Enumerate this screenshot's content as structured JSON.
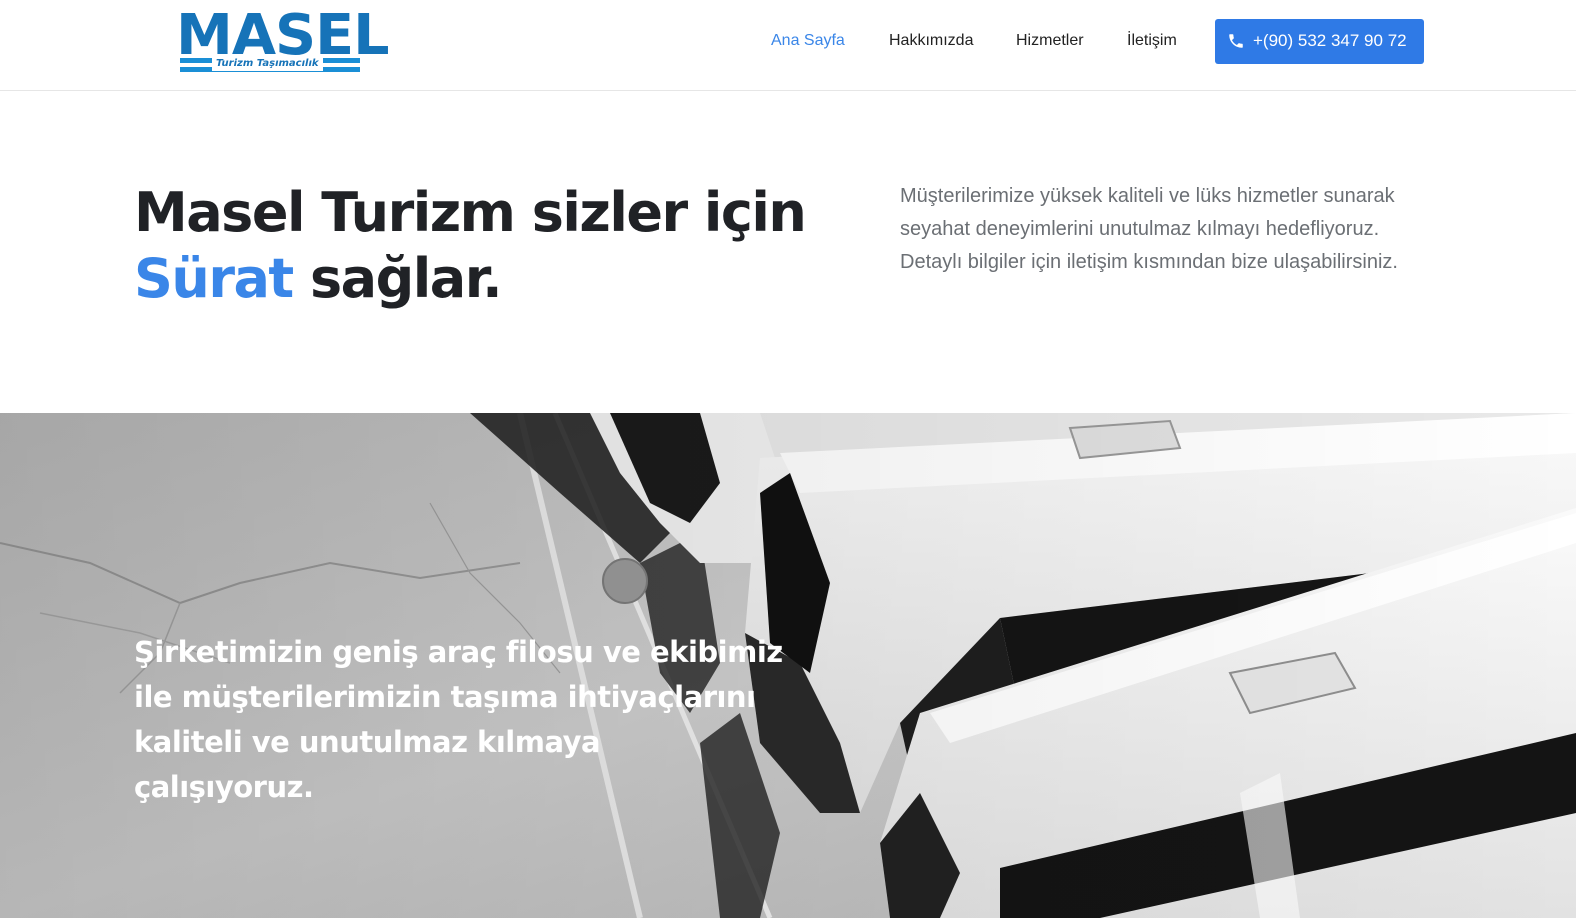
{
  "brand": {
    "logo_word": "MASEL",
    "logo_tagline": "Turizm Taşımacılık",
    "color": "#1673b8"
  },
  "nav": {
    "items": [
      {
        "label": "Ana Sayfa",
        "active": true
      },
      {
        "label": "Hakkımızda",
        "active": false
      },
      {
        "label": "Hizmetler",
        "active": false
      },
      {
        "label": "İletişim",
        "active": false
      }
    ],
    "phone_label": "+(90) 532 347 90 72",
    "phone_icon": "phone-icon",
    "accent_color": "#2f7ae6"
  },
  "hero": {
    "title_line1": "Masel Turizm sizler için",
    "title_accent": "Sürat",
    "title_rest": " sağlar.",
    "description": "Müşterilerimize yüksek kaliteli ve lüks hizmetler sunarak seyahat deneyimlerini unutulmaz kılmayı hedefliyoruz. Detaylı bilgiler için iletişim kısmından bize ulaşabilirsiniz.",
    "accent_color": "#3a86e8"
  },
  "feature": {
    "overlay_text": "Şirketimizin geniş araç filosu ve ekibimiz ile müşterilerimizin taşıma ihtiyaçlarını kaliteli ve unutulmaz kılmaya çalışıyoruz."
  }
}
